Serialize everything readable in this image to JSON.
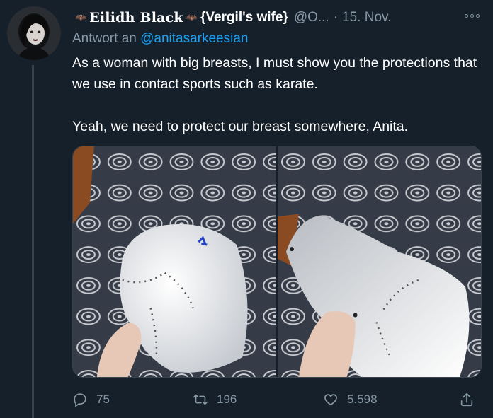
{
  "author": {
    "display_name": "Eilidh Black",
    "nickname": "{Vergil's wife}",
    "handle": "@O...",
    "date_separator": "·",
    "date": "15. Nov.",
    "avatar_icon": "profile-photo"
  },
  "reply": {
    "prefix": "Antwort an",
    "mention": "@anitasarkeesian"
  },
  "tweet_text": {
    "line1": "As a woman with big breasts, I must show you the protections that we use in contact sports such as karate.",
    "line2": "Yeah, we need to protect our breast somewhere, Anita."
  },
  "media": {
    "count": 2,
    "icons": [
      "photo-breast-protector-front",
      "photo-breast-protector-side"
    ]
  },
  "actions": {
    "replies": "75",
    "retweets": "196",
    "likes": "5.598"
  },
  "colors": {
    "background": "#15202b",
    "text": "#ffffff",
    "muted": "#8899a6",
    "link": "#1da1f2",
    "divider": "#38444d"
  }
}
